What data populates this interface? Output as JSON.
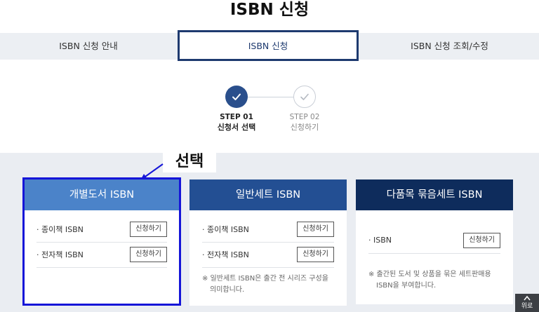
{
  "page": {
    "title": "ISBN 신청"
  },
  "tabs": [
    {
      "label": "ISBN 신청 안내"
    },
    {
      "label": "ISBN 신청"
    },
    {
      "label": "ISBN 신청 조회/수정"
    }
  ],
  "steps": [
    {
      "number": "STEP 01",
      "name": "신청서 선택"
    },
    {
      "number": "STEP 02",
      "name": "신청하기"
    }
  ],
  "annotation": {
    "label": "선택"
  },
  "cards": [
    {
      "title": "개별도서 ISBN",
      "rows": [
        {
          "label": "· 종이책 ISBN",
          "button": "신청하기"
        },
        {
          "label": "· 전자책 ISBN",
          "button": "신청하기"
        }
      ]
    },
    {
      "title": "일반세트 ISBN",
      "rows": [
        {
          "label": "· 종이책 ISBN",
          "button": "신청하기"
        },
        {
          "label": "· 전자책 ISBN",
          "button": "신청하기"
        }
      ],
      "note_lines": [
        "※ 일반세트 ISBN은 출간 전 시리즈 구성을",
        "의미합니다."
      ]
    },
    {
      "title": "다품목 묶음세트 ISBN",
      "rows": [
        {
          "label": "· ISBN",
          "button": "신청하기"
        }
      ],
      "note_lines": [
        "※ 출간된 도서 및 상품을 묶은 세트판매용",
        "ISBN을 부여합니다."
      ]
    }
  ],
  "top_button": {
    "label": "위로"
  },
  "colors": {
    "accent": "#2a4f8c",
    "highlight": "#1515d8"
  }
}
